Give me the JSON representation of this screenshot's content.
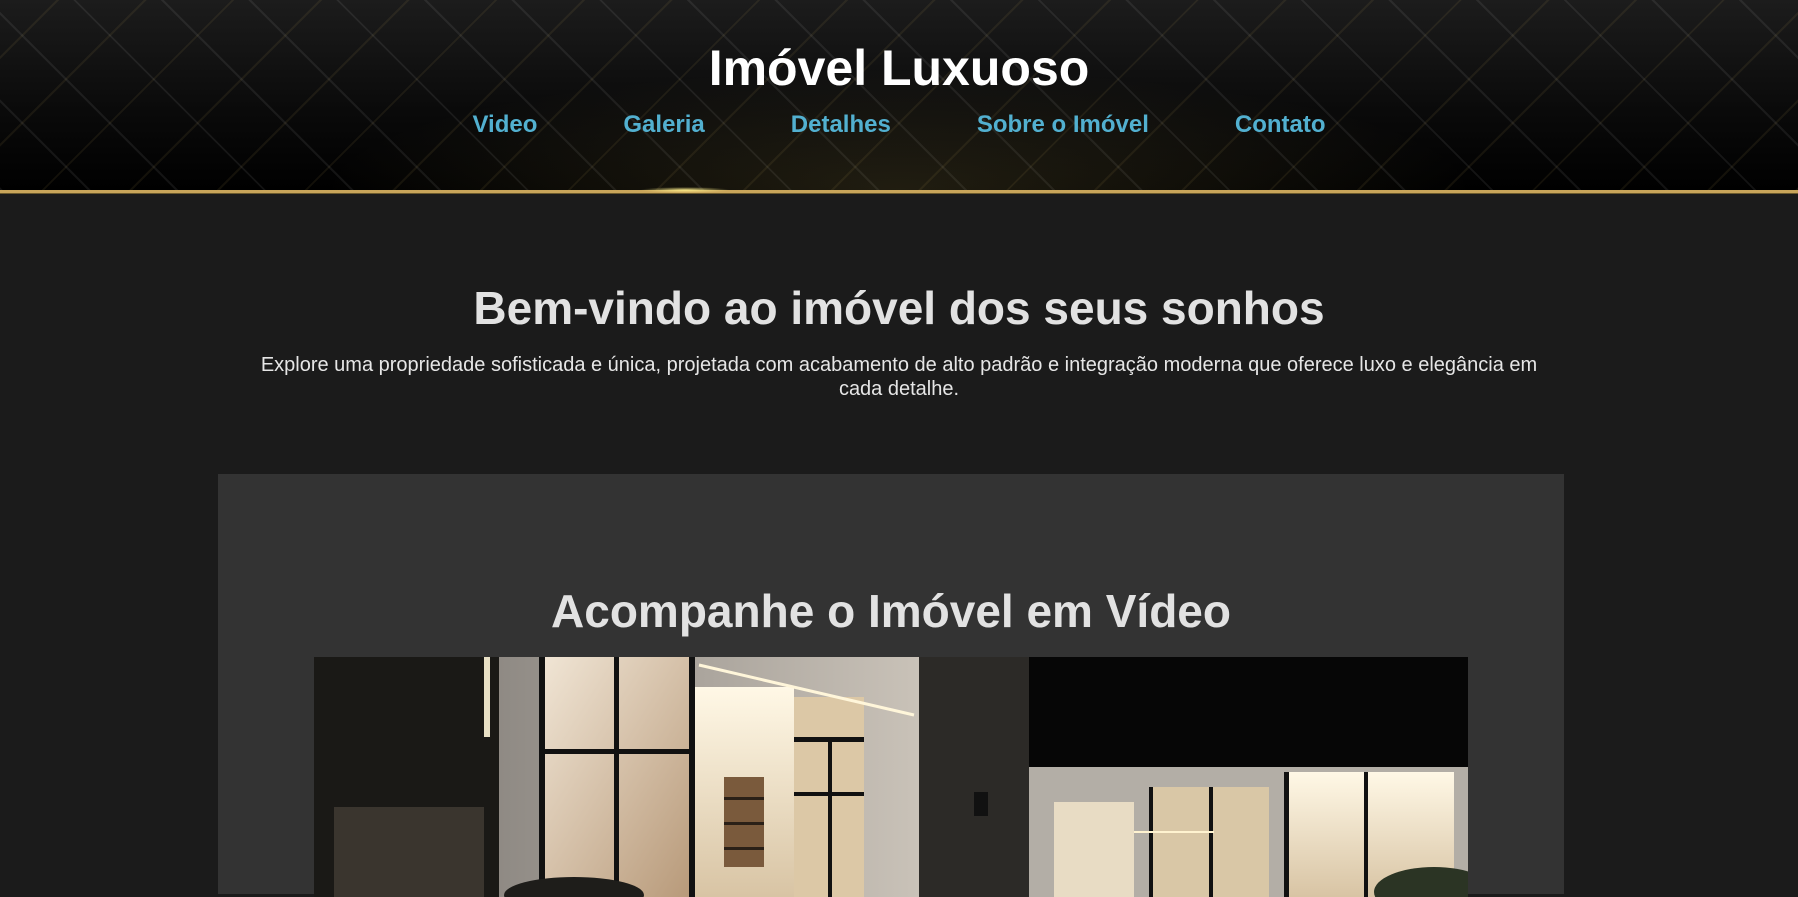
{
  "header": {
    "title": "Imóvel Luxuoso",
    "nav": [
      "Video",
      "Galeria",
      "Detalhes",
      "Sobre o Imóvel",
      "Contato"
    ]
  },
  "hero": {
    "heading": "Bem-vindo ao imóvel dos seus sonhos",
    "text": "Explore uma propriedade sofisticada e única, projetada com acabamento de alto padrão e integração moderna que oferece luxo e elegância em cada detalhe."
  },
  "video_section": {
    "heading": "Acompanhe o Imóvel em Vídeo"
  },
  "colors": {
    "accent_link": "#52b0d0",
    "gold_line": "#c9a55a",
    "page_bg": "#1b1b1b",
    "section_bg": "#333333"
  }
}
